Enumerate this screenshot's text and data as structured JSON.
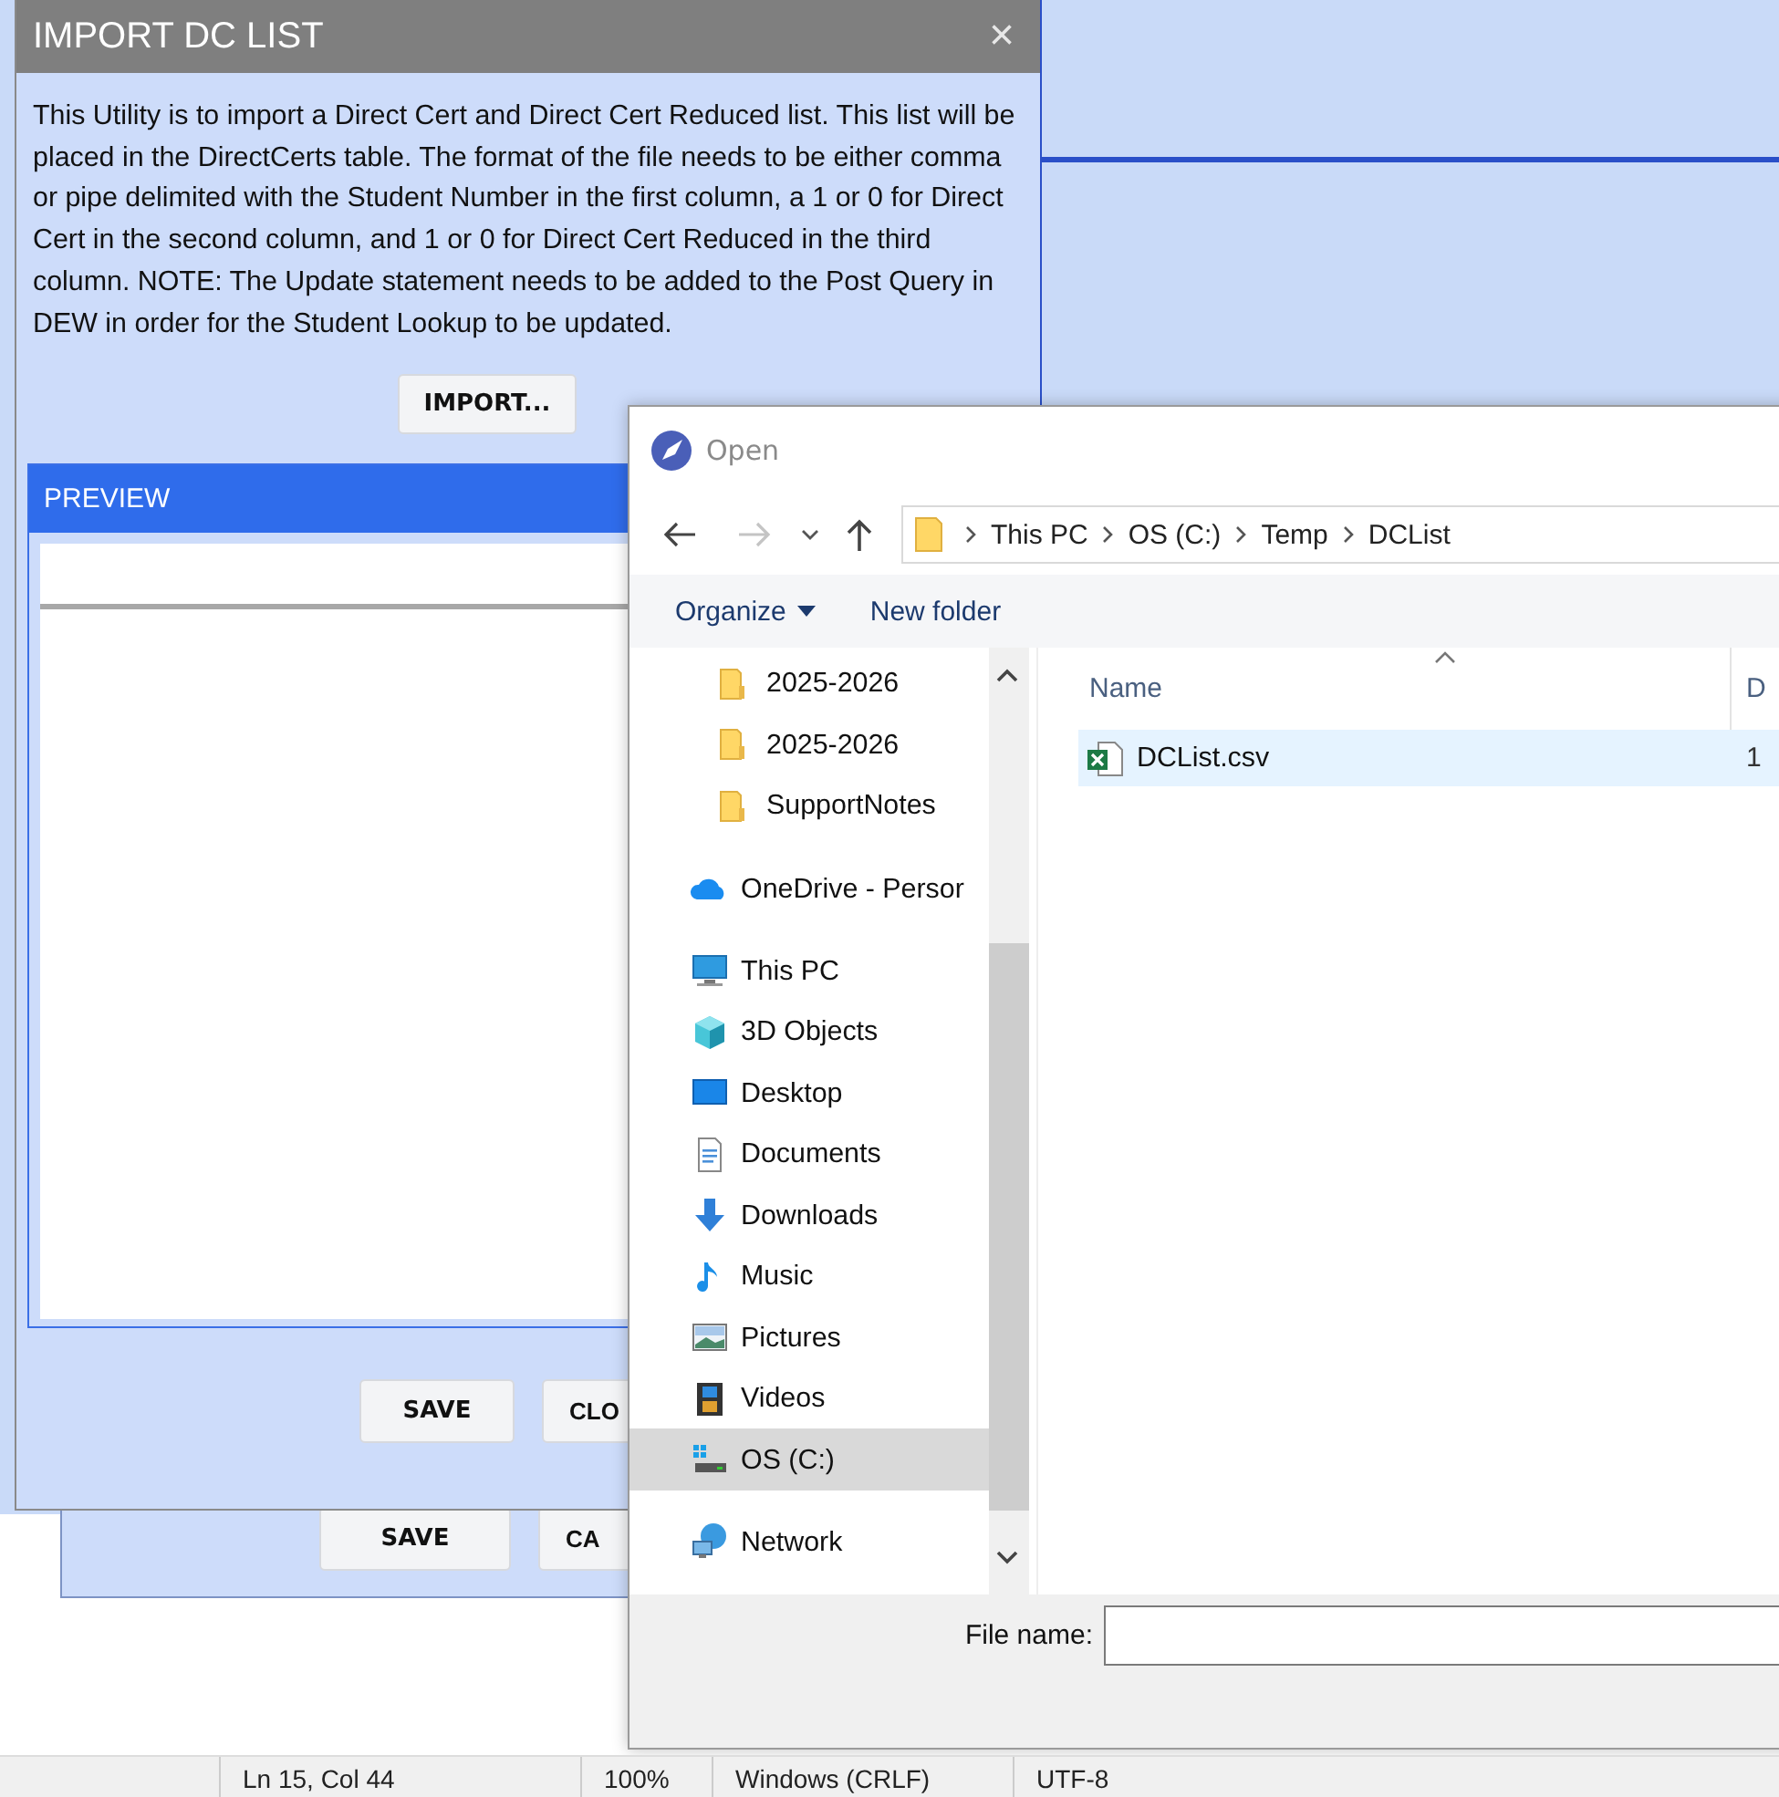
{
  "background_dialog": {
    "buttons": [
      "SAVE",
      "CA"
    ]
  },
  "import_dialog": {
    "title": "IMPORT DC LIST",
    "close": "×",
    "description": "This Utility is to import a Direct Cert and Direct Cert Reduced list. This list will be placed in the DirectCerts table. The format of the file needs to be either comma or pipe delimited with the Student Number in the first column, a 1 or 0 for Direct Cert in the second column, and 1 or 0 for Direct Cert Reduced in the third column. NOTE: The Update statement needs to be added to the Post Query in DEW in order for the Student Lookup to be updated.",
    "import_button": "IMPORT...",
    "preview": {
      "title": "PREVIEW"
    },
    "buttons": [
      "SAVE",
      "CLO"
    ]
  },
  "open_dialog": {
    "title": "Open",
    "breadcrumbs": [
      "This PC",
      "OS (C:)",
      "Temp",
      "DCList"
    ],
    "toolbar": [
      {
        "label": "Organize",
        "kind": "menu"
      },
      {
        "label": "New folder",
        "kind": "button"
      }
    ],
    "nav_pane": {
      "pinned": [
        {
          "label": "2025-2026",
          "kind": "folder",
          "selected": false
        },
        {
          "label": "2025-2026",
          "kind": "folder",
          "selected": false
        },
        {
          "label": "SupportNotes",
          "kind": "folder",
          "selected": false
        }
      ],
      "locations": [
        {
          "label": "OneDrive - Persor",
          "kind": "onedrive",
          "selected": false
        },
        {
          "label": "This PC",
          "kind": "pc",
          "selected": false,
          "children": [
            {
              "label": "3D Objects",
              "kind": "objects",
              "selected": false
            },
            {
              "label": "Desktop",
              "kind": "desktop",
              "selected": false
            },
            {
              "label": "Documents",
              "kind": "documents",
              "selected": false
            },
            {
              "label": "Downloads",
              "kind": "downloads",
              "selected": false
            },
            {
              "label": "Music",
              "kind": "music",
              "selected": false
            },
            {
              "label": "Pictures",
              "kind": "pictures",
              "selected": false
            },
            {
              "label": "Videos",
              "kind": "videos",
              "selected": false
            },
            {
              "label": "OS (C:)",
              "kind": "drive",
              "selected": true
            }
          ]
        },
        {
          "label": "Network",
          "kind": "network",
          "selected": false
        }
      ]
    },
    "columns": [
      "Name",
      "D"
    ],
    "files": [
      {
        "name": "DCList.csv",
        "kind": "csv",
        "column_2": "1",
        "selected": true
      }
    ],
    "file_name": {
      "label": "File name:"
    }
  },
  "status_bar": [
    "Ln 15, Col 44",
    "100%",
    "Windows (CRLF)",
    "UTF-8"
  ]
}
